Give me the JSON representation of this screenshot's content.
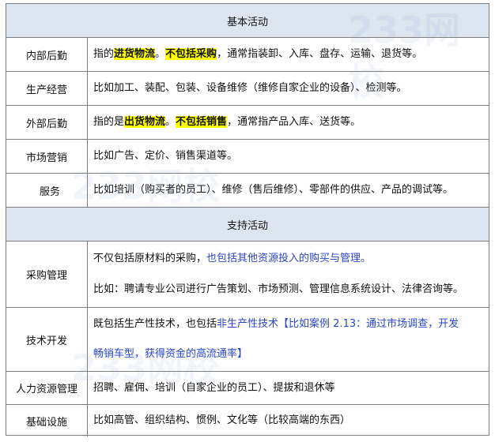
{
  "section1_title": "基本活动",
  "section2_title": "支持活动",
  "rows": {
    "internal_logistics": {
      "label": "内部后勤",
      "p1": "指的",
      "h1": "进货物流",
      "p2": "。",
      "h2": "不包括采购",
      "p3": "，通常指装卸、入库、盘存、运输、退货等。"
    },
    "operations": {
      "label": "生产经营",
      "text": "比如加工、装配、包装、设备维修（维修自家企业的设备）、检测等。"
    },
    "external_logistics": {
      "label": "外部后勤",
      "p1": "指的是",
      "h1": "出货物流",
      "p2": "。",
      "h2": "不包括销售",
      "p3": "，通常指产品入库、送货等。"
    },
    "marketing": {
      "label": "市场营销",
      "text": "比如广告、定价、销售渠道等。"
    },
    "service": {
      "label": "服务",
      "text": "比如培训（购买者的员工）、维修（售后维修）、零部件的供应、产品的调试等。"
    },
    "procurement": {
      "label": "采购管理",
      "line1_a": "不仅包括原材料的采购，",
      "line1_b": "也包括其他资源投入的购买与管理。",
      "line2": "比如：聘请专业公司进行广告策划、市场预测、管理信息系统设计、法律咨询等。"
    },
    "technology": {
      "label": "技术开发",
      "line1_a": "既包括生产性技术，也包括",
      "line1_b": "非生产性技术",
      "line1_c": "【比如案例 2.13：通过市场调查，开发",
      "line2": "畅销车型，获得资金的高流通率】"
    },
    "hr": {
      "label": "人力资源管理",
      "text": "招聘、雇佣、培训（自家企业的员工）、提拔和退休等"
    },
    "infrastructure": {
      "label": "基础设施",
      "text": "比如高管、组织结构、惯例、文化等（比较高端的东西）"
    }
  },
  "watermark_text": "233网校"
}
